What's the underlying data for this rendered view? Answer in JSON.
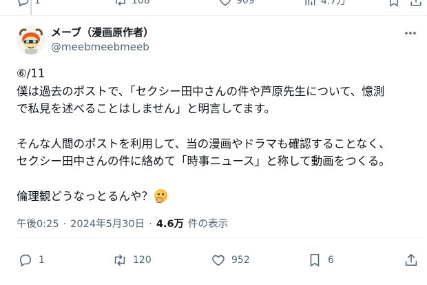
{
  "previous_post": {
    "reply_count": "1",
    "repost_count": "108",
    "like_count": "909",
    "view_count": "4.7万"
  },
  "author": {
    "display_name": "メーブ（漫画原作者）",
    "handle": "@meebmeebmeeb"
  },
  "post": {
    "lines": [
      "⑥/11",
      "僕は過去のポストで、「セクシー田中さんの件や芦原先生について、憶測",
      "で私見を述べることはしません」と明言してます。",
      "",
      "そんな人間のポストを利用して、当の漫画やドラマも確認することなく、",
      "セクシー田中さんの件に絡めて「時事ニュース」と称して動画をつくる。",
      "",
      "倫理観どうなっとるんや？"
    ],
    "emoji_name": "thinking-face-emoji"
  },
  "meta": {
    "time": "午後0:25",
    "separator1": "·",
    "date": "2024年5月30日",
    "separator2": "·",
    "views": "4.6万",
    "views_label": "件の表示"
  },
  "actions": {
    "reply_count": "1",
    "repost_count": "120",
    "like_count": "952",
    "bookmark_count": "6"
  },
  "colors": {
    "text": "#0f1419",
    "secondary": "#536471",
    "divider": "#eff3f4"
  }
}
